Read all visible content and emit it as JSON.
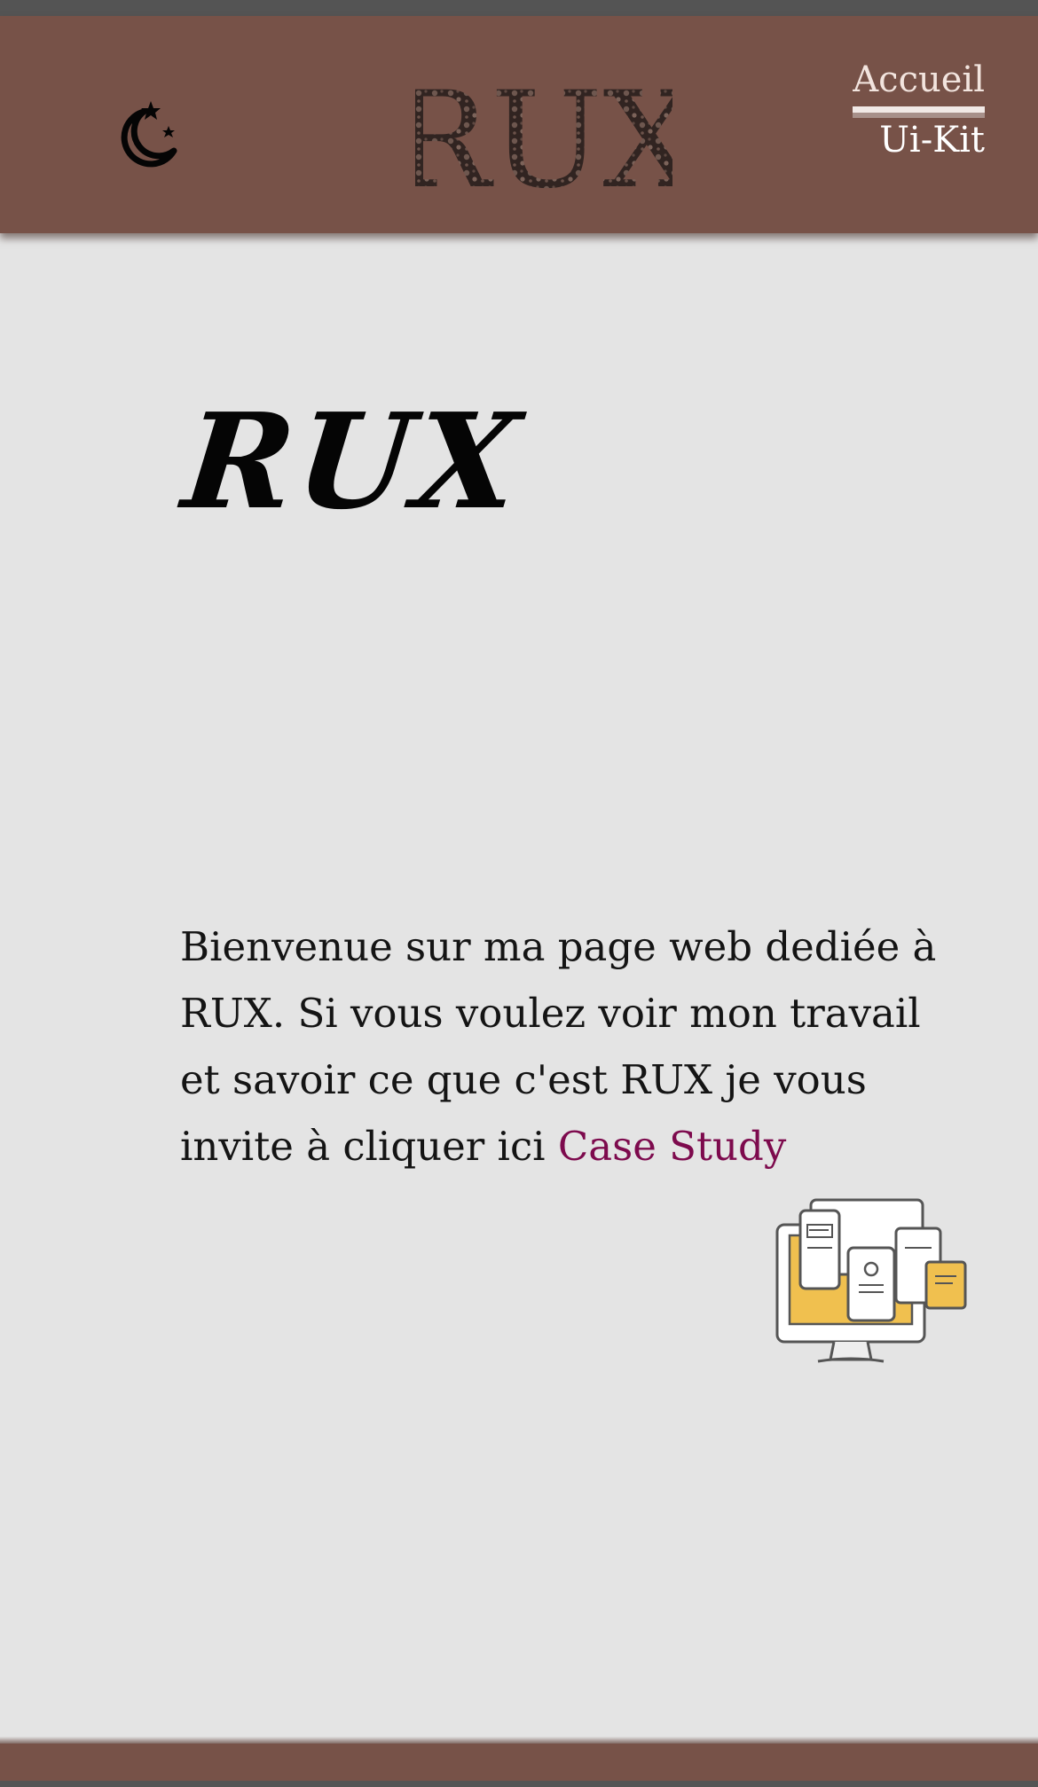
{
  "header": {
    "theme_toggle_icon": "moon-stars-icon",
    "logo_text": "RUX",
    "nav": {
      "items": [
        {
          "label": "Accueil",
          "active": true
        },
        {
          "label": "Ui-Kit",
          "active": false
        }
      ]
    }
  },
  "main": {
    "title": "RUX",
    "intro_text": "Bienvenue sur ma page web dediée à RUX. Si vous voulez voir mon travail et savoir ce que c'est RUX je vous invite à cliquer ici ",
    "case_study_link": "Case Study",
    "illustration_icon": "responsive-devices-illustration"
  },
  "colors": {
    "header_background": "#775248",
    "page_background": "#e4e4e4",
    "link_color": "#7d0a4d",
    "illustration_accent": "#f0c04f"
  }
}
